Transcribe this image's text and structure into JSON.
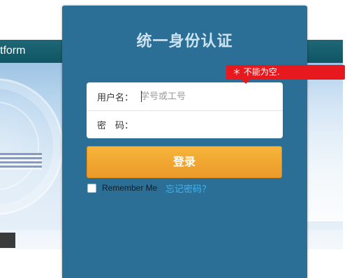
{
  "background": {
    "title_fragment": "tform"
  },
  "login": {
    "title": "统一身份认证",
    "username_label": "用户名：",
    "username_placeholder": "学号或工号",
    "username_value": "",
    "password_label": "密　码：",
    "password_value": "",
    "login_button": "登录",
    "remember_label": "Remember Me",
    "remember_checked": false,
    "forgot_link": "忘记密码？"
  },
  "validation": {
    "message": "＊ 不能为空."
  },
  "colors": {
    "card": "#2b6f96",
    "title": "#cde3f2",
    "button": "#f0a32e",
    "link": "#3fb4f2",
    "error": "#e8191e",
    "banner_bar": "#1f6777"
  }
}
